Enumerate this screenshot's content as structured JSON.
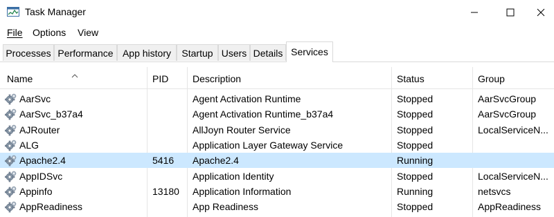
{
  "window": {
    "title": "Task Manager",
    "icon": "task-manager-icon",
    "controls": [
      "minimize-icon",
      "maximize-icon",
      "close-icon"
    ]
  },
  "menu": {
    "file": "File",
    "options": "Options",
    "view": "View"
  },
  "tabs": {
    "processes": "Processes",
    "performance": "Performance",
    "app_history": "App history",
    "startup": "Startup",
    "users": "Users",
    "details": "Details",
    "services": "Services",
    "active": "Services"
  },
  "columns": {
    "name": "Name",
    "pid": "PID",
    "description": "Description",
    "status": "Status",
    "group": "Group",
    "sorted_by": "Name"
  },
  "rows": [
    {
      "name": "AarSvc",
      "pid": "",
      "description": "Agent Activation Runtime",
      "status": "Stopped",
      "group": "AarSvcGroup"
    },
    {
      "name": "AarSvc_b37a4",
      "pid": "",
      "description": "Agent Activation Runtime_b37a4",
      "status": "Stopped",
      "group": "AarSvcGroup"
    },
    {
      "name": "AJRouter",
      "pid": "",
      "description": "AllJoyn Router Service",
      "status": "Stopped",
      "group": "LocalServiceN..."
    },
    {
      "name": "ALG",
      "pid": "",
      "description": "Application Layer Gateway Service",
      "status": "Stopped",
      "group": ""
    },
    {
      "name": "Apache2.4",
      "pid": "5416",
      "description": "Apache2.4",
      "status": "Running",
      "group": ""
    },
    {
      "name": "AppIDSvc",
      "pid": "",
      "description": "Application Identity",
      "status": "Stopped",
      "group": "LocalServiceN..."
    },
    {
      "name": "Appinfo",
      "pid": "13180",
      "description": "Application Information",
      "status": "Running",
      "group": "netsvcs"
    },
    {
      "name": "AppReadiness",
      "pid": "",
      "description": "App Readiness",
      "status": "Stopped",
      "group": "AppReadiness"
    }
  ],
  "selected_row": "Apache2.4",
  "colors": {
    "selection": "#cce8ff",
    "tab_inactive": "#f0f0f0",
    "border": "#d9d9d9"
  }
}
